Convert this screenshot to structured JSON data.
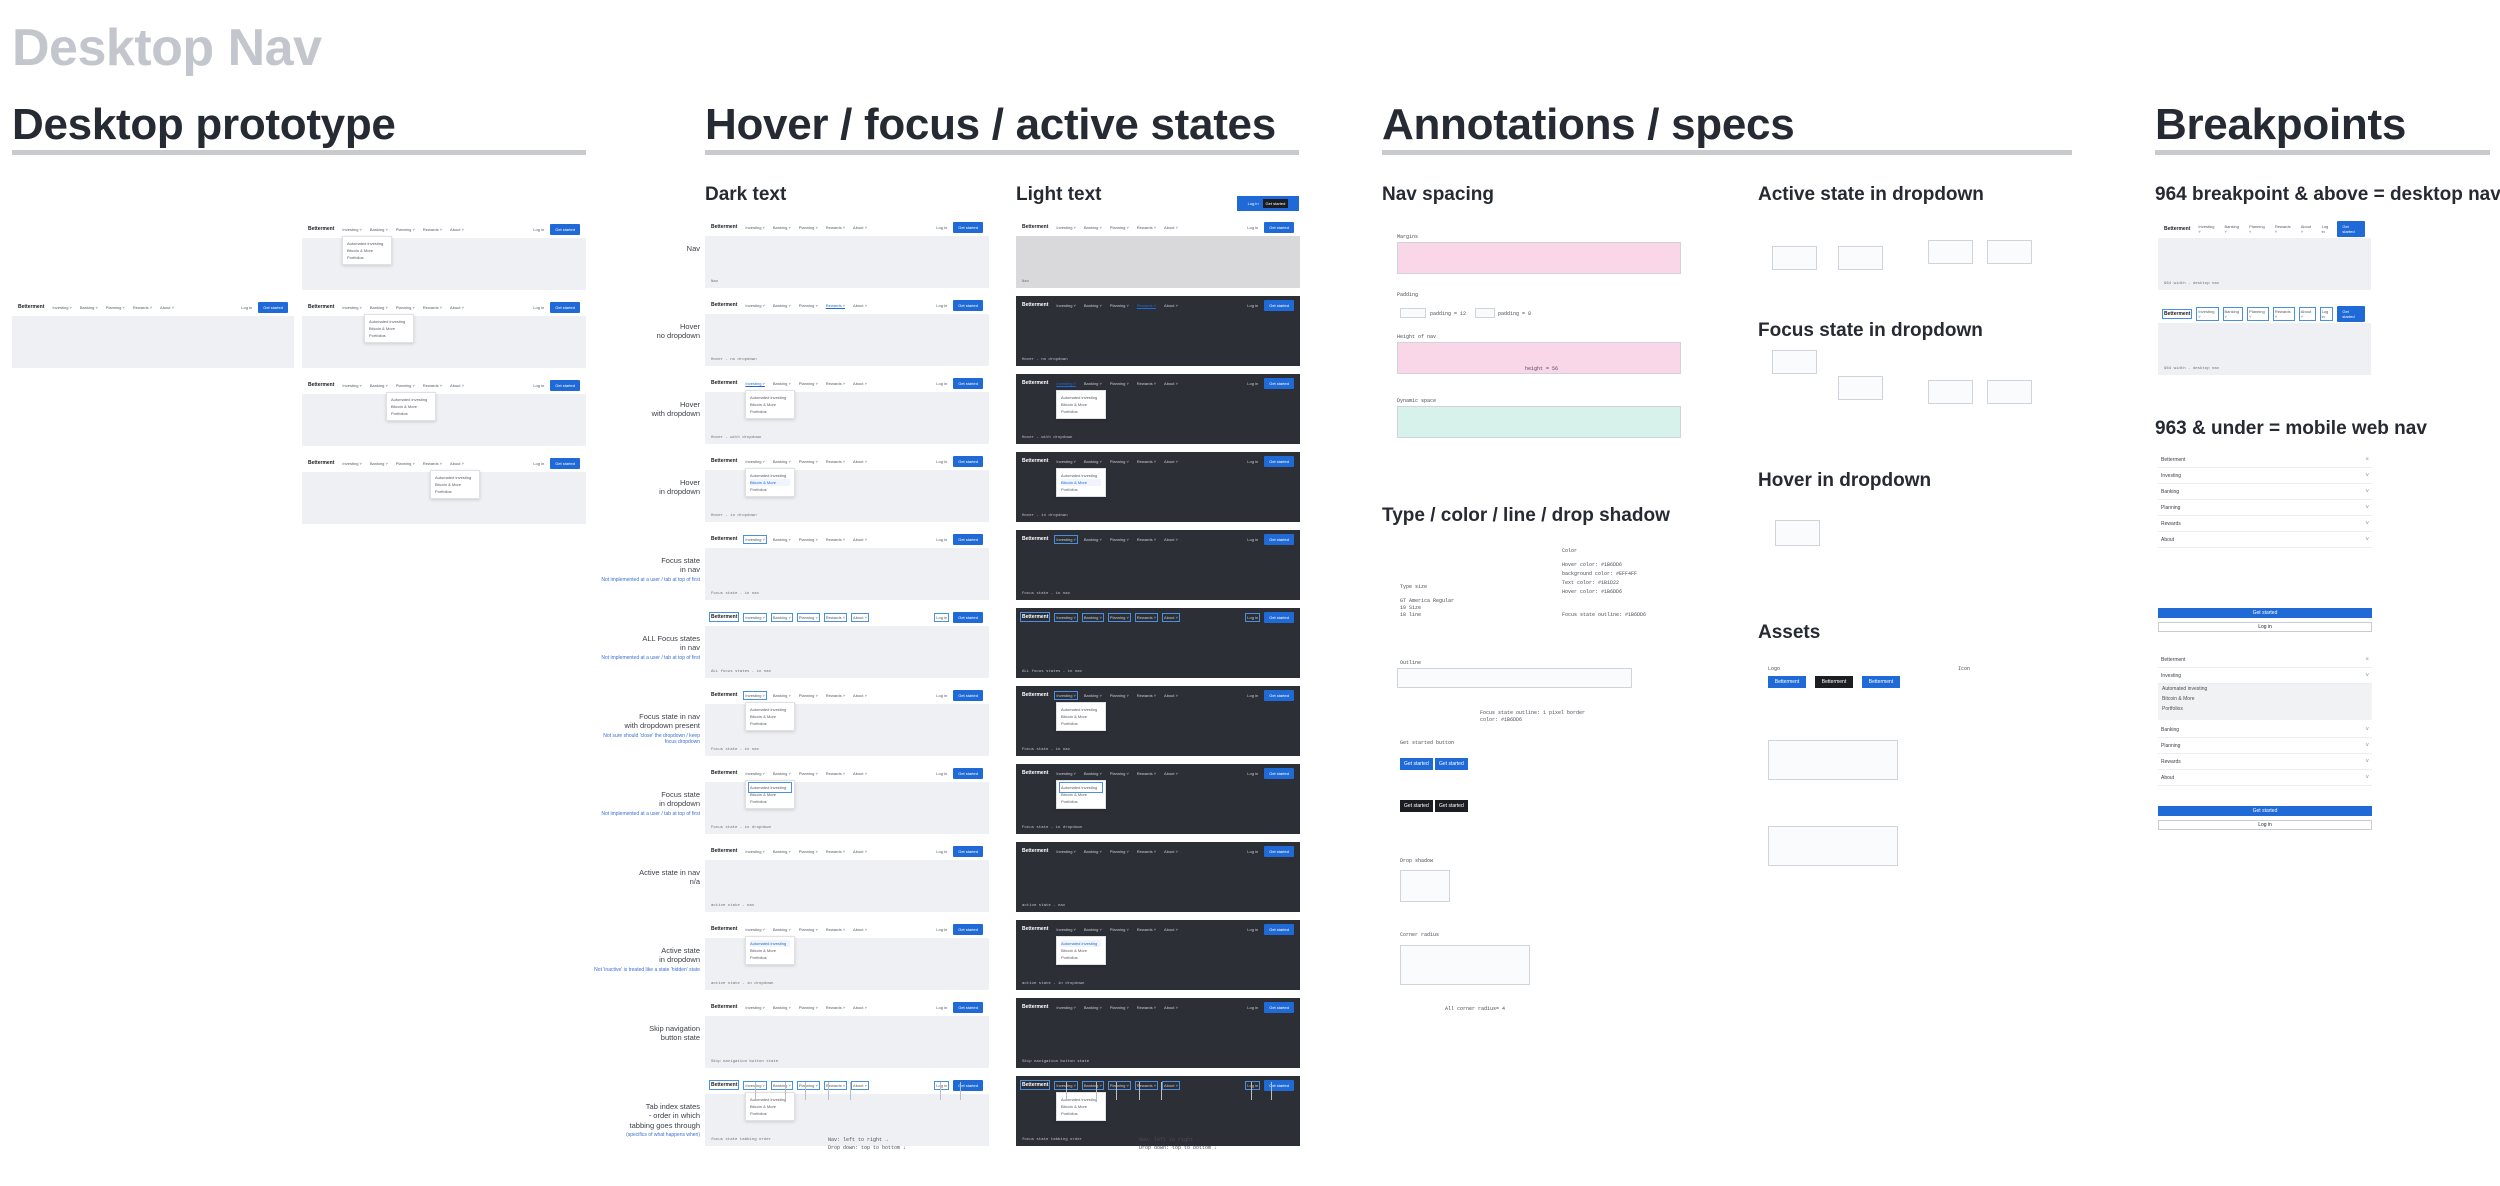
{
  "page": {
    "title": "Desktop Nav"
  },
  "columns": {
    "prototype": {
      "title": "Desktop prototype"
    },
    "states": {
      "title": "Hover / focus  / active states",
      "dark_text": "Dark text",
      "light_text": "Light text"
    },
    "specs": {
      "title": "Annotations / specs"
    },
    "breakpoints": {
      "title": "Breakpoints"
    }
  },
  "nav": {
    "logo": "Betterment",
    "items": [
      "Investing",
      "Banking",
      "Planning",
      "Rewards",
      "About"
    ],
    "login": "Log in",
    "cta": "Get started"
  },
  "dropdown_items": [
    "Automated investing",
    "Bitcoin & More",
    "Portfolios"
  ],
  "state_rows": [
    {
      "label": "Nav",
      "caption": "Nav"
    },
    {
      "label": "Hover\nno dropdown",
      "caption": "Hover - no dropdown"
    },
    {
      "label": "Hover\nwith dropdown",
      "caption": "Hover - with dropdown"
    },
    {
      "label": "Hover\nin dropdown",
      "caption": "Hover - in dropdown"
    },
    {
      "label": "Focus state\nin nav",
      "caption": "Focus state - in nav",
      "note": "Not implemented at a user / tab at top of first"
    },
    {
      "label": "ALL Focus states\nin nav",
      "caption": "ALL focus states - in nav",
      "note": "Not implemented at a user / tab at top of first"
    },
    {
      "label": "Focus state in nav\nwith dropdown present",
      "caption": "Focus state - in nav",
      "note": "Not sure should 'close' the dropdown / keep focus dropdown"
    },
    {
      "label": "Focus state\nin dropdown",
      "caption": "Focus state - in dropdown",
      "note": "Not implemented at a user / tab at top of first"
    },
    {
      "label": "Active state in nav\nn/a",
      "caption": "active state - nav"
    },
    {
      "label": "Active state\nin dropdown",
      "caption": "active state - in dropdown",
      "note": "Not 'inactive' is treated like a state 'hidden' state"
    },
    {
      "label": "Skip navigation\nbutton state",
      "caption": "Skip navigation button state"
    },
    {
      "label": "Tab index states\n- order in which\ntabbing goes through",
      "caption": "focus state tabbing order",
      "note": "(specifics of what happens when)"
    }
  ],
  "tab_order_text": {
    "line1": "Nav: left to right →",
    "line2": "Drop down: top to bottom ↓"
  },
  "specs": {
    "nav_spacing": "Nav spacing",
    "type_color": "Type / color / line / drop shadow",
    "margins": "Margins",
    "padding": "Padding",
    "height_of_nav": "Height of nav",
    "dynamic_space": "Dynamic space",
    "padding_note": "padding = 12",
    "padding_note2": "padding = 8",
    "height_note": "height = 56",
    "type_size": "Type size",
    "type_specs": [
      "GT America Regular",
      "10 Size",
      "18 line"
    ],
    "color": "Color",
    "colors": [
      "Hover color: #1B6DD6",
      "background color: #EFF4FF",
      "Text color: #1B1D22",
      "Hover color: #1B6DD6"
    ],
    "focus_outline": "Focus state outline: #1B6DD6",
    "outline": "Outline",
    "outline_note": [
      "Focus state outline: 1 pixel border",
      "color: #1B6DD6"
    ],
    "get_started": "Get started button",
    "drop_shadow": "Drop shadow",
    "corner_radius": "Corner radius",
    "corner_note": "All corner radius= 4",
    "active_state": "Active state in dropdown",
    "focus_state": "Focus state in dropdown",
    "hover_dropdown": "Hover in dropdown",
    "assets": "Assets",
    "logo_label": "Logo",
    "icon_label": "Icon"
  },
  "breakpoints": {
    "desktop": "964 breakpoint & above = desktop nav",
    "mobile": "963 & under = mobile web nav",
    "caption1": "964 width - desktop nav",
    "caption2": "964 width - desktop nav",
    "mobile_items": [
      "Betterment",
      "Investing",
      "Banking",
      "Planning",
      "Rewards",
      "About"
    ],
    "mobile_expanded": [
      "Automated investing",
      "Bitcoin & More",
      "Portfolios"
    ],
    "mobile_cta": "Get started",
    "mobile_login": "Log in"
  },
  "colors": {
    "accent": "#1f6ad6",
    "dark": "#2c2f36",
    "light": "#eff0f3",
    "rule": "#c8cacd"
  }
}
